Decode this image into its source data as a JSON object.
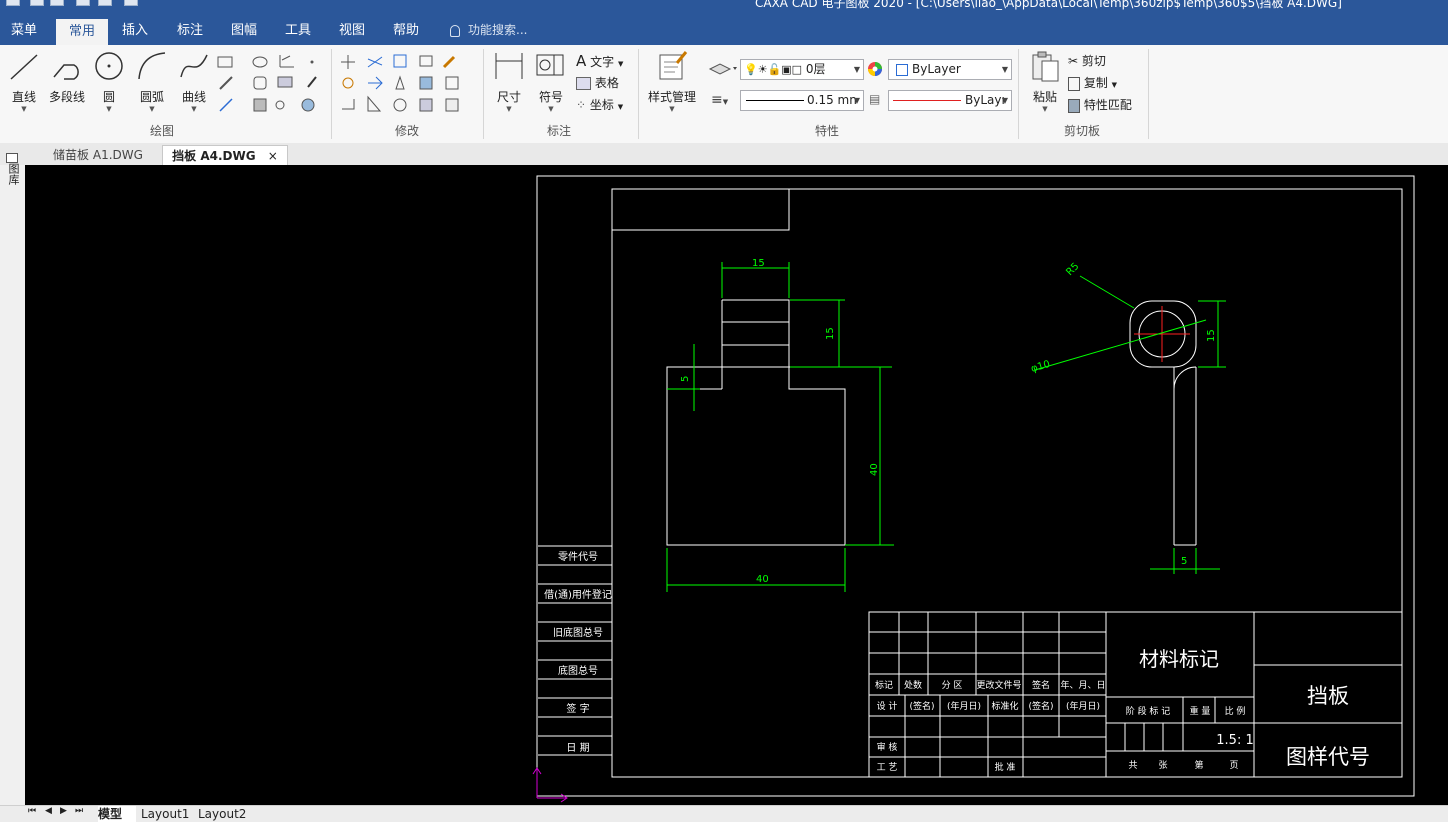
{
  "window": {
    "title": "CAXA CAD 电子图板 2020 - [C:\\Users\\liao_\\AppData\\Local\\Temp\\360zip$Temp\\360$5\\挡板 A4.DWG]"
  },
  "menubar": {
    "items": [
      "菜单",
      "常用",
      "插入",
      "标注",
      "图幅",
      "工具",
      "视图",
      "帮助"
    ],
    "active": "常用",
    "search_placeholder": "功能搜索..."
  },
  "ribbon": {
    "draw": {
      "label": "绘图",
      "buttons": [
        "直线",
        "多段线",
        "圆",
        "圆弧",
        "曲线"
      ]
    },
    "modify": {
      "label": "修改"
    },
    "annotate": {
      "label": "标注",
      "buttons": [
        "尺寸",
        "符号"
      ],
      "small": [
        "文字",
        "表格",
        "坐标"
      ]
    },
    "properties": {
      "label": "特性",
      "style_button": "样式管理",
      "layer_value": "0层",
      "color_value": "ByLayer",
      "linewidth_value": "0.15 mn",
      "linetype_value": "ByLayı"
    },
    "clipboard": {
      "label": "剪切板",
      "paste": "粘贴",
      "small": [
        "剪切",
        "复制",
        "特性匹配"
      ]
    }
  },
  "doc_tabs": [
    {
      "label": "储苗板 A1.DWG",
      "active": false
    },
    {
      "label": "挡板 A4.DWG",
      "active": true
    }
  ],
  "side_panel": {
    "label": "图库"
  },
  "drawing": {
    "dimensions": {
      "top_width": "15",
      "step_height": "15",
      "left_step": "5",
      "body_height": "40",
      "bottom_width": "40",
      "side_height": "15",
      "radius": "R5",
      "diameter": "φ10",
      "side_thickness": "5"
    },
    "left_column": [
      "零件代号",
      "借(通)用件登记",
      "旧底图总号",
      "底图总号",
      "签 字",
      "日 期"
    ],
    "title_block": {
      "material": "材料标记",
      "part_name": "挡板",
      "drawing_code": "图样代号",
      "scale": "1.5: 1",
      "header_row": [
        "标记",
        "处数",
        "分 区",
        "更改文件号",
        "签名",
        "年、月、日"
      ],
      "design_row": [
        "设 计",
        "(签名)",
        "(年月日)",
        "标准化",
        "(签名)",
        "(年月日)"
      ],
      "review": "审 核",
      "process": "工 艺",
      "approve": "批 准",
      "stage_labels": [
        "阶 段 标 记",
        "重 量",
        "比 例"
      ],
      "sheets": [
        "共",
        "张",
        "第",
        "页"
      ]
    }
  },
  "layout_tabs": [
    "模型",
    "Layout1",
    "Layout2"
  ],
  "colors": {
    "accent": "#2b579a",
    "canvas": "#000000",
    "dimension": "#00ff00",
    "center": "#ff0000",
    "ucs": "#d400d4"
  }
}
